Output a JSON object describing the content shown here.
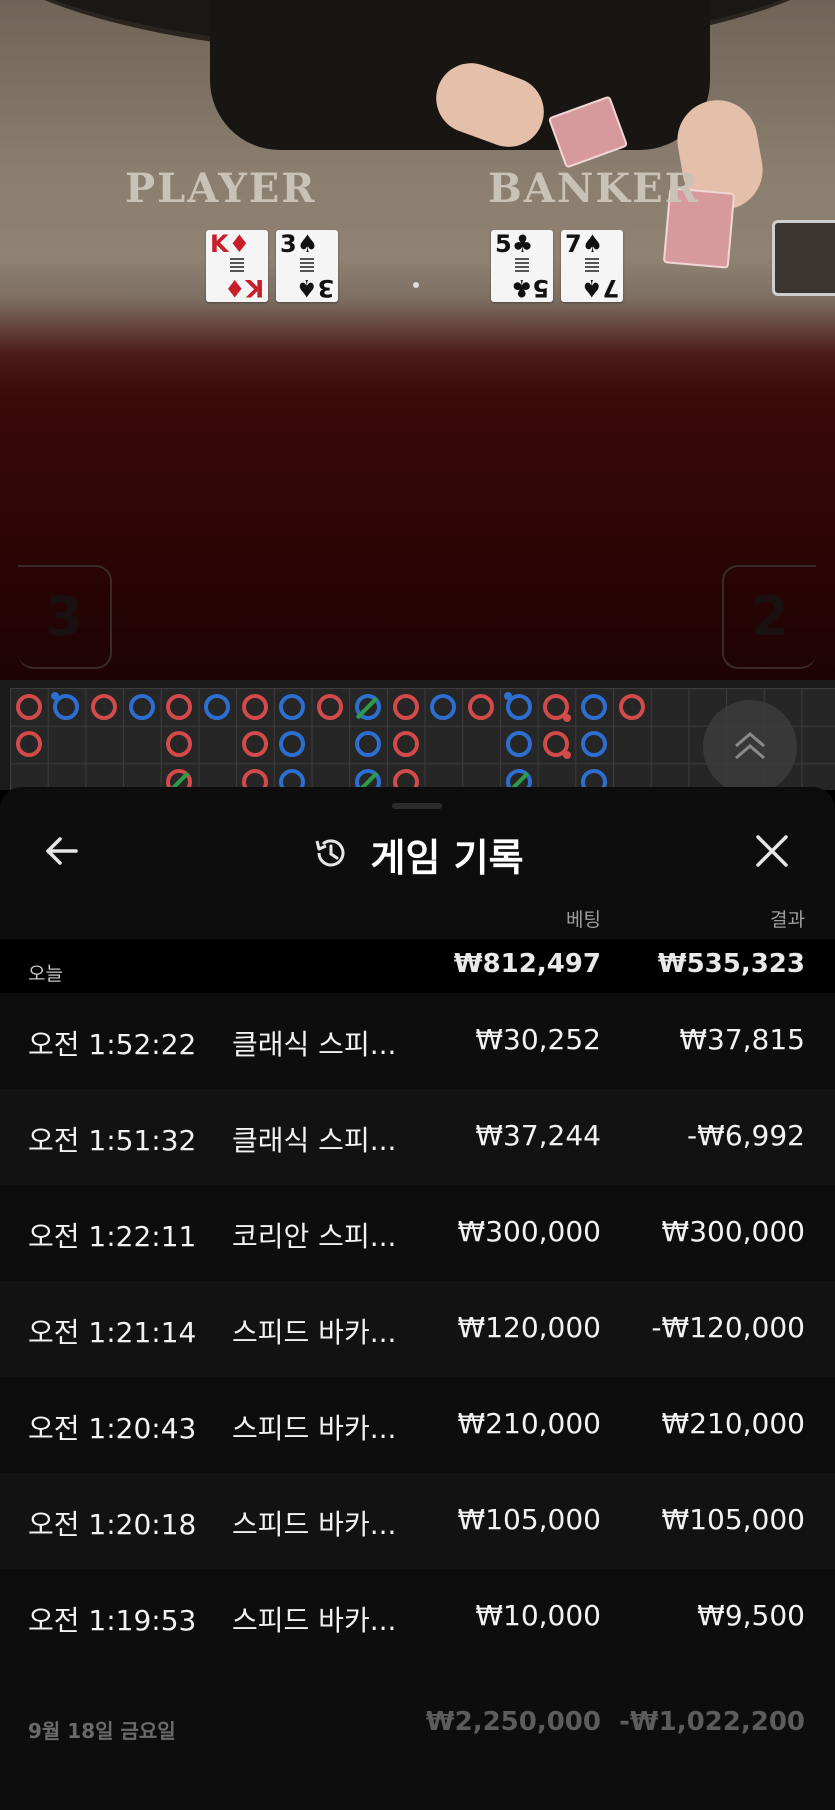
{
  "table": {
    "player_label": "PLAYER",
    "banker_label": "BANKER",
    "player_cards": [
      {
        "rank": "K",
        "suit": "♦",
        "color": "red"
      },
      {
        "rank": "3",
        "suit": "♠",
        "color": "black"
      }
    ],
    "banker_cards": [
      {
        "rank": "5",
        "suit": "♣",
        "color": "black"
      },
      {
        "rank": "7",
        "suit": "♠",
        "color": "black"
      }
    ],
    "player_score": "3",
    "banker_score": "2"
  },
  "road_map": {
    "colors": {
      "player": "#2c6fd1",
      "banker": "#d24a4a",
      "tie": "#2e9a4a"
    }
  },
  "history": {
    "title": "게임 기록",
    "columns": {
      "bet": "베팅",
      "result": "결과"
    },
    "today": {
      "label": "오늘",
      "bet": "₩812,497",
      "result": "₩535,323"
    },
    "rows": [
      {
        "time": "오전 1:52:22",
        "game": "클래식 스피...",
        "bet": "₩30,252",
        "result": "₩37,815"
      },
      {
        "time": "오전 1:51:32",
        "game": "클래식 스피...",
        "bet": "₩37,244",
        "result": "-₩6,992"
      },
      {
        "time": "오전 1:22:11",
        "game": "코리안 스피...",
        "bet": "₩300,000",
        "result": "₩300,000"
      },
      {
        "time": "오전 1:21:14",
        "game": "스피드 바카...",
        "bet": "₩120,000",
        "result": "-₩120,000"
      },
      {
        "time": "오전 1:20:43",
        "game": "스피드 바카...",
        "bet": "₩210,000",
        "result": "₩210,000"
      },
      {
        "time": "오전 1:20:18",
        "game": "스피드 바카...",
        "bet": "₩105,000",
        "result": "₩105,000"
      },
      {
        "time": "오전 1:19:53",
        "game": "스피드 바카...",
        "bet": "₩10,000",
        "result": "₩9,500"
      }
    ],
    "previous_day": {
      "label": "9월 18일 금요일",
      "bet": "₩2,250,000",
      "result": "-₩1,022,200"
    }
  },
  "icons": {
    "back": "arrow-left-icon",
    "close": "close-icon",
    "history": "history-icon",
    "expand": "chevron-up-double-icon"
  }
}
